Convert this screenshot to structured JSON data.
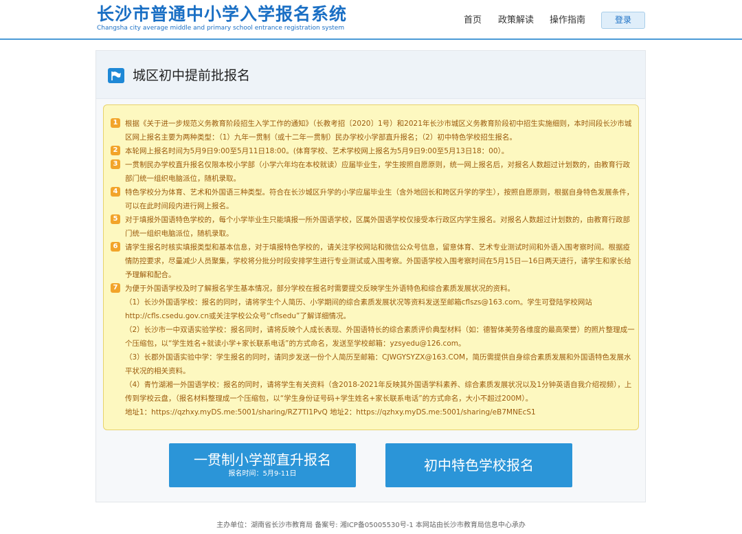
{
  "header": {
    "logo_title": "长沙市普通中小学入学报名系统",
    "logo_subtitle": "Changsha city average middle and primary school entrance registration system",
    "nav": [
      "首页",
      "政策解读",
      "操作指南"
    ],
    "login_label": "登录"
  },
  "panel": {
    "icon": "flag-icon",
    "title": "城区初中提前批报名"
  },
  "notice": {
    "items": [
      {
        "num": "1",
        "text": "根据《关于进一步规范义务教育阶段招生入学工作的通知》（长教考招〔2020〕1号）和2021年长沙市城区义务教育阶段初中招生实施细则，本时间段长沙市城区网上报名主要为两种类型：（1）九年一贯制（或十二年一贯制）民办学校小学部直升报名；（2）初中特色学校招生报名。"
      },
      {
        "num": "2",
        "text": "本轮网上报名时间为5月9日9:00至5月11日18:00。(体育学校、艺术学校网上报名为5月9日9:00至5月13日18：00）。"
      },
      {
        "num": "3",
        "text": "一贯制民办学校直升报名仅限本校小学部（小学六年均在本校就读）应届毕业生，学生按照自愿原则，统一网上报名后，对报名人数超过计划数的，由教育行政部门统一组织电脑派位，随机录取。"
      },
      {
        "num": "4",
        "text": "特色学校分为体育、艺术和外国语三种类型。符合在长沙城区升学的小学应届毕业生（含外地回长和跨区升学的学生），按照自愿原则，根据自身特色发展条件，可以在此时间段内进行网上报名。"
      },
      {
        "num": "5",
        "text": "对于填报外国语特色学校的，每个小学毕业生只能填报一所外国语学校，区属外国语学校仅接受本行政区内学生报名。对报名人数超过计划数的，由教育行政部门统一组织电脑派位，随机录取。"
      },
      {
        "num": "6",
        "text": "请学生报名时核实填报类型和基本信息，对于填报特色学校的，请关注学校网站和微信公众号信息，留意体育、艺术专业测试时间和外语入围考察时间。根据疫情防控要求，尽量减少人员聚集，学校将分批分时段安排学生进行专业测试或入围考察。外国语学校入围考察时间在5月15日—16日两天进行，请学生和家长给予理解和配合。"
      },
      {
        "num": "7",
        "text": "为便于外国语学校及时了解报名学生基本情况，部分学校在报名时需要提交反映学生外语特色和综合素质发展状况的资料。"
      }
    ],
    "sub_items": [
      "（1）长沙外国语学校：报名的同时，请将学生个人简历、小学期间的综合素质发展状况等资料发送至邮箱cflszs@163.com。学生可登陆学校网站http://cfls.csedu.gov.cn或关注学校公众号“cflsedu”了解详细情况。",
      "（2）长沙市一中双语实验学校：报名同时，请将反映个人成长表现、外国语特长的综合素质评价典型材料（如：德智体美劳各维度的最高荣誉）的照片整理成一个压缩包，以“学生姓名+就读小学+家长联系电话”的方式命名，发送至学校邮箱：yzsyedu@126.com。",
      "（3）长郡外国语实验中学：学生报名的同时，请同步发送一份个人简历至邮箱：CJWGYSYZX@163.COM，简历需提供自身综合素质发展和外国语特色发展水平状况的相关资料。",
      "（4）青竹湖湘一外国语学校：报名的同时，请将学生有关资料（含2018-2021年反映其外国语学科素养、综合素质发展状况以及1分钟英语自我介绍视频），上传到学校云盘，（报名材料整理成一个压缩包，以“学生身份证号码+学生姓名+家长联系电话”的方式命名，大小不超过200M）。",
      "地址1：https://qzhxy.myDS.me:5001/sharing/RZ7TI1PvQ 地址2：https://qzhxy.myDS.me:5001/sharing/eB7MNEcS1"
    ]
  },
  "buttons": {
    "btn1_label": "一贯制小学部直升报名",
    "btn1_sub": "报名时间：5月9-11日",
    "btn2_label": "初中特色学校报名"
  },
  "footer": {
    "text": "主办单位：湖南省长沙市教育局    备案号: 湘ICP备05005530号-1 本网站由长沙市教育局信息中心承办"
  },
  "colors": {
    "brand": "#1a6fc4",
    "button": "#2b95d8",
    "notice_bg": "#fdf8c0",
    "notice_text": "#9b5a0c",
    "badge": "#f2a42a"
  }
}
